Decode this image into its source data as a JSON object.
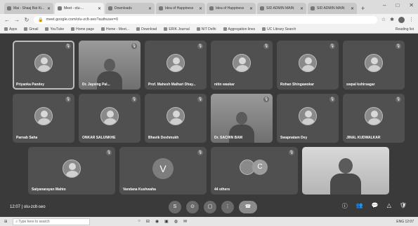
{
  "browser": {
    "tabs": [
      {
        "title": "Mai - Shaaj Bat Ki..."
      },
      {
        "title": "Meet - olu-...",
        "active": true
      },
      {
        "title": "Downloads"
      },
      {
        "title": "Idea of Happiness"
      },
      {
        "title": "Idea of Happiness"
      },
      {
        "title": "SID ADMIN MAIN"
      },
      {
        "title": "SID ADMIN MAIN"
      }
    ],
    "new_tab": "+",
    "window_controls": [
      "–",
      "□",
      "✕"
    ],
    "url": "meet.google.com/olu-zclt-seo?authuser=0",
    "bookmarks": [
      "Apps",
      "Gmail",
      "YouTube",
      "Home page",
      "Home - Meet...",
      "Download",
      "ERIK Journal",
      "NIT Delhi",
      "Aggregation lines",
      "UC Library Search"
    ],
    "reading_list": "Reading list"
  },
  "meet": {
    "row1": [
      {
        "name": "Priyanka Pandey",
        "type": "avatar",
        "highlight": true
      },
      {
        "name": "Dr. Jaysing Pal...",
        "type": "video"
      },
      {
        "name": "Prof. Mahesh Malhari Dhay...",
        "type": "avatar"
      },
      {
        "name": "nitin waskar",
        "type": "avatar"
      },
      {
        "name": "Rohan Shingawokar",
        "type": "avatar"
      },
      {
        "name": "swpal kshirsagar",
        "type": "avatar"
      }
    ],
    "row2": [
      {
        "name": "Parnab Saha",
        "type": "avatar"
      },
      {
        "name": "ONKAR SALUNKHE",
        "type": "avatar"
      },
      {
        "name": "Bhavik Deshmukh",
        "type": "avatar"
      },
      {
        "name": "Dr. SACHIN BAM",
        "type": "video"
      },
      {
        "name": "Swapnatam Dey",
        "type": "avatar"
      },
      {
        "name": "JINAL KUDWALKAR",
        "type": "avatar"
      }
    ],
    "row3": [
      {
        "name": "Satyanarayan Mahto",
        "type": "avatar"
      },
      {
        "name": "Vandana Kushwaha",
        "type": "letter",
        "letter": "V"
      },
      {
        "name": "44 others",
        "type": "others",
        "letter": "C"
      },
      {
        "name": "",
        "type": "self-video"
      }
    ],
    "mic_icon": "🎙"
  },
  "controls": {
    "time": "12:07",
    "meeting_code": "olu-zclt-seo",
    "separator": "|",
    "center_buttons": [
      "S",
      "⊙",
      "▢",
      "⋮"
    ],
    "end_call": "☎",
    "right_icons": [
      "ⓘ",
      "👥",
      "💬",
      "△",
      "🛡"
    ]
  },
  "taskbar": {
    "search_placeholder": "Type here to search",
    "icons": [
      "○",
      "⊟",
      "◉",
      "▣",
      "◍",
      "✉"
    ],
    "tray": "ENG  12:07"
  }
}
